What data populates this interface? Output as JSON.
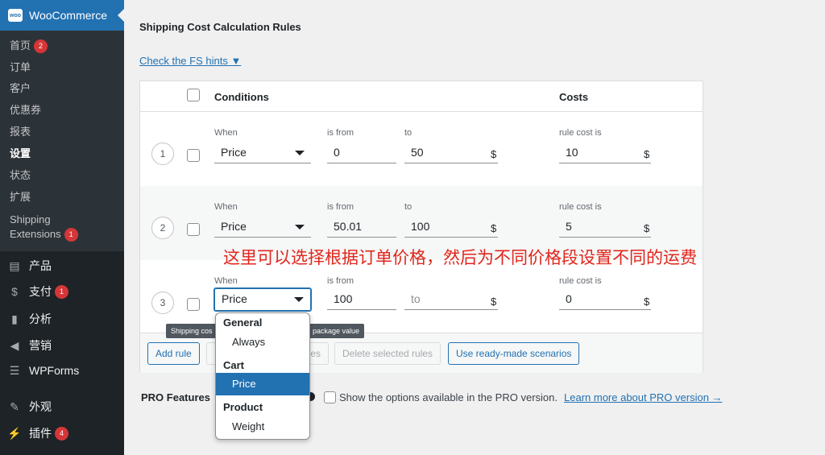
{
  "sidebar": {
    "header": {
      "logo": "woo",
      "title": "WooCommerce"
    },
    "submenu": [
      {
        "label": "首页",
        "badge": "2"
      },
      {
        "label": "订单"
      },
      {
        "label": "客户"
      },
      {
        "label": "优惠券"
      },
      {
        "label": "报表"
      },
      {
        "label": "设置",
        "current": true
      },
      {
        "label": "状态"
      },
      {
        "label": "扩展"
      },
      {
        "label": "Shipping",
        "label2": "Extensions",
        "badge": "1"
      }
    ],
    "menu": [
      {
        "label": "产品",
        "icon": "archive-icon"
      },
      {
        "label": "支付",
        "icon": "dollar-icon",
        "badge": "1"
      },
      {
        "label": "分析",
        "icon": "chart-icon"
      },
      {
        "label": "营销",
        "icon": "megaphone-icon"
      },
      {
        "label": "WPForms",
        "icon": "form-icon"
      },
      {
        "label": "外观",
        "icon": "brush-icon"
      },
      {
        "label": "插件",
        "icon": "plugin-icon",
        "badge": "4"
      }
    ]
  },
  "main": {
    "section_title": "Shipping Cost Calculation Rules",
    "hints_link": "Check the FS hints ▼",
    "table": {
      "headers": {
        "conditions": "Conditions",
        "costs": "Costs"
      },
      "labels": {
        "when": "When",
        "from": "is from",
        "to": "to",
        "cost": "rule cost is",
        "currency": "$"
      },
      "rows": [
        {
          "num": "1",
          "when": "Price",
          "from": "0",
          "to": "50",
          "cost": "10"
        },
        {
          "num": "2",
          "when": "Price",
          "from": "50.01",
          "to": "100",
          "cost": "5"
        },
        {
          "num": "3",
          "when": "Price",
          "from": "100",
          "to": "to",
          "cost": "0"
        }
      ]
    },
    "buttons": {
      "add_rule": "Add rule",
      "hidden_rules": "les",
      "delete_selected": "Delete selected rules",
      "ready_made": "Use ready-made scenarios"
    },
    "tooltip": {
      "left": "Shipping cos",
      "right": "package value"
    },
    "pro": {
      "label": "PRO Features",
      "checkbox_text": "Show the options available in the PRO version.",
      "link": "Learn more about PRO version →"
    },
    "dropdown": {
      "groups": [
        {
          "label": "General",
          "options": [
            "Always"
          ]
        },
        {
          "label": "Cart",
          "options": [
            "Price"
          ]
        },
        {
          "label": "Product",
          "options": [
            "Weight"
          ]
        }
      ],
      "selected": "Price"
    },
    "annotation": "这里可以选择根据订单价格，然后为不同价格段设置不同的运费"
  },
  "colors": {
    "accent": "#2271b1",
    "sidebar": "#1d2327",
    "badge": "#d63638",
    "annotation": "#e2261c"
  }
}
